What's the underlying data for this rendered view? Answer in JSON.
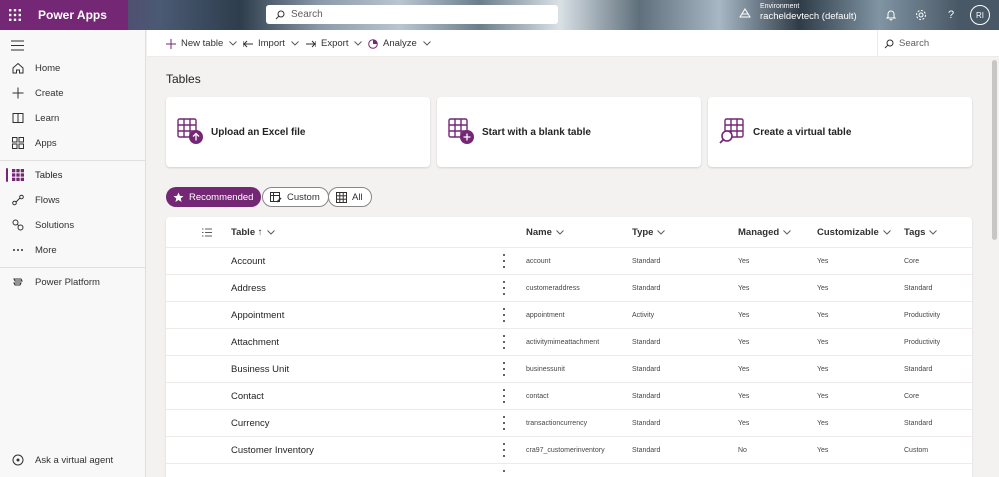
{
  "app": {
    "title": "Power Apps",
    "brand_color": "#742774"
  },
  "search": {
    "placeholder": "Search"
  },
  "environment": {
    "label": "Environment",
    "value": "racheldevtech (default)"
  },
  "user": {
    "initials": "RI"
  },
  "nav": {
    "items": [
      {
        "label": "Home",
        "icon": "home-icon"
      },
      {
        "label": "Create",
        "icon": "plus-icon"
      },
      {
        "label": "Learn",
        "icon": "book-icon"
      },
      {
        "label": "Apps",
        "icon": "apps-icon"
      },
      {
        "label": "Tables",
        "icon": "table-icon",
        "active": true
      },
      {
        "label": "Flows",
        "icon": "flow-icon"
      },
      {
        "label": "Solutions",
        "icon": "solutions-icon"
      },
      {
        "label": "More",
        "icon": "more-icon"
      },
      {
        "label": "Power Platform",
        "icon": "power-platform-icon"
      }
    ],
    "ask_agent": "Ask a virtual agent"
  },
  "commandbar": {
    "new_table": "New table",
    "import": "Import",
    "export": "Export",
    "analyze": "Analyze",
    "search": "Search"
  },
  "page": {
    "title": "Tables"
  },
  "cards": [
    {
      "label": "Upload an Excel file",
      "icon": "upload-table-icon"
    },
    {
      "label": "Start with a blank table",
      "icon": "add-table-icon"
    },
    {
      "label": "Create a virtual table",
      "icon": "virtual-table-icon"
    }
  ],
  "filters": [
    {
      "label": "Recommended",
      "icon": "star-icon",
      "selected": true
    },
    {
      "label": "Custom",
      "icon": "custom-table-icon",
      "selected": false
    },
    {
      "label": "All",
      "icon": "grid-icon",
      "selected": false
    }
  ],
  "table": {
    "columns": [
      "Table ↑",
      "Name",
      "Type",
      "Managed",
      "Customizable",
      "Tags"
    ],
    "rows": [
      [
        "Account",
        "account",
        "Standard",
        "Yes",
        "Yes",
        "Core"
      ],
      [
        "Address",
        "customeraddress",
        "Standard",
        "Yes",
        "Yes",
        "Standard"
      ],
      [
        "Appointment",
        "appointment",
        "Activity",
        "Yes",
        "Yes",
        "Productivity"
      ],
      [
        "Attachment",
        "activitymimeattachment",
        "Standard",
        "Yes",
        "Yes",
        "Productivity"
      ],
      [
        "Business Unit",
        "businessunit",
        "Standard",
        "Yes",
        "Yes",
        "Standard"
      ],
      [
        "Contact",
        "contact",
        "Standard",
        "Yes",
        "Yes",
        "Core"
      ],
      [
        "Currency",
        "transactioncurrency",
        "Standard",
        "Yes",
        "Yes",
        "Standard"
      ],
      [
        "Customer Inventory",
        "cra97_customerinventory",
        "Standard",
        "No",
        "Yes",
        "Custom"
      ]
    ]
  }
}
